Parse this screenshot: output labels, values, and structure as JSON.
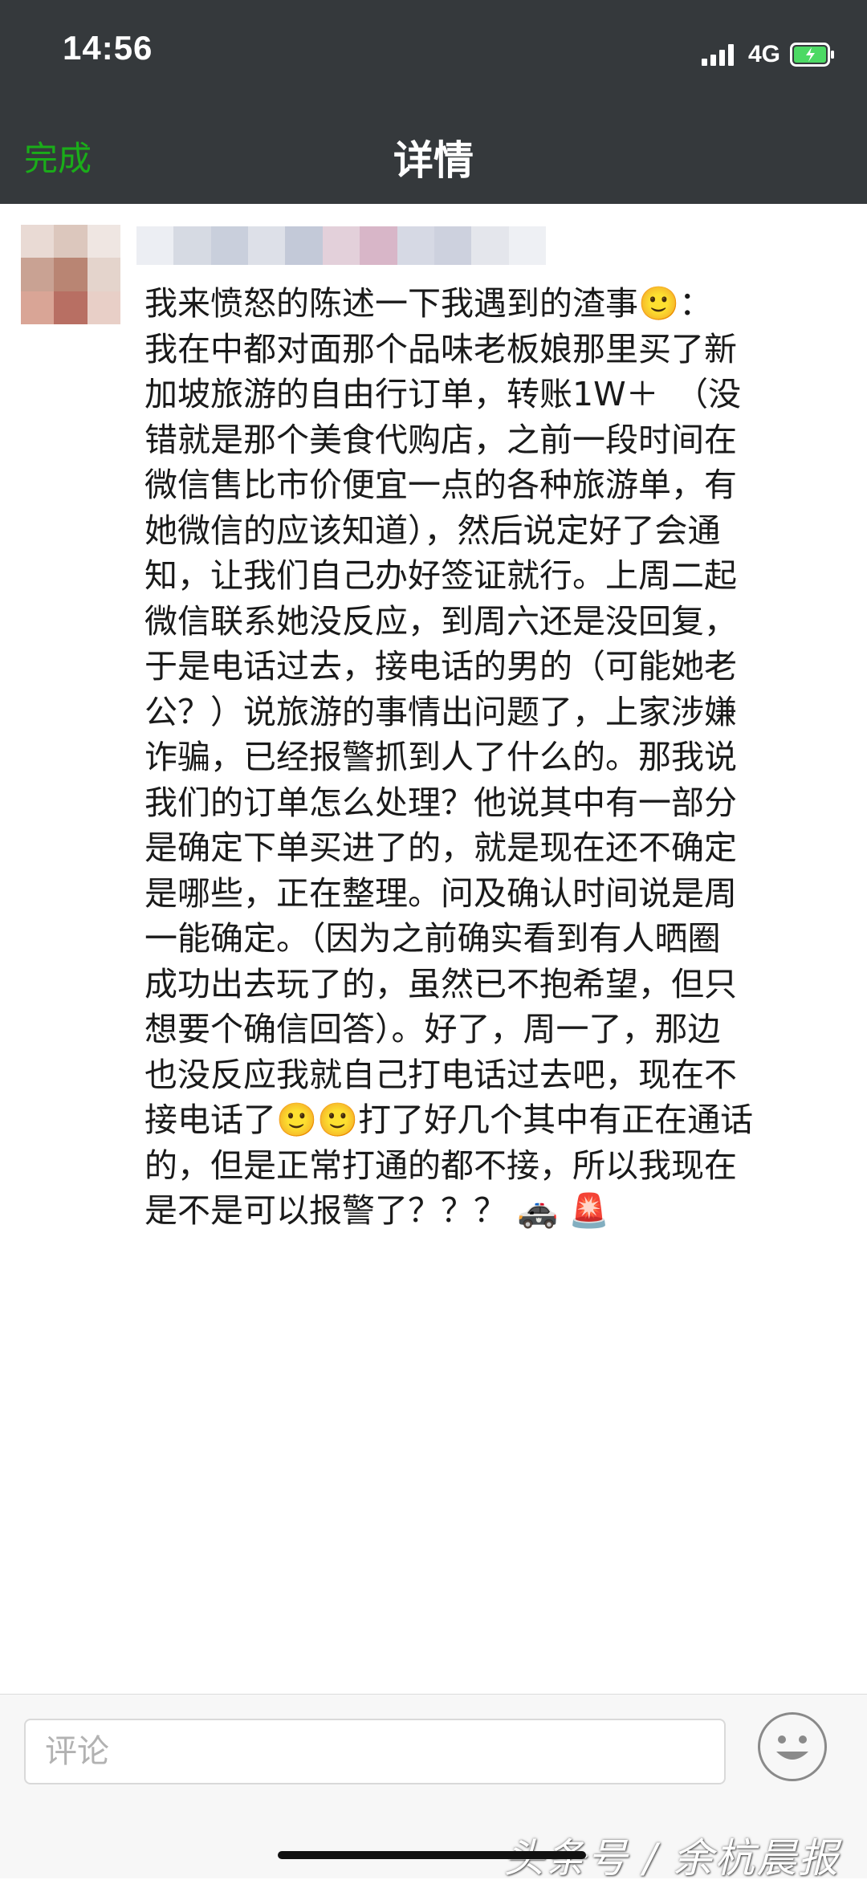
{
  "status_bar": {
    "time": "14:56",
    "network": "4G"
  },
  "nav": {
    "done_label": "完成",
    "title": "详情"
  },
  "post": {
    "text": "我来愤怒的陈述一下我遇到的渣事🙂：\n我在中都对面那个品味老板娘那里买了新\n加坡旅游的自由行订单，转账1W＋　（没\n错就是那个美食代购店，之前一段时间在\n微信售比市价便宜一点的各种旅游单，有\n她微信的应该知道），然后说定好了会通\n知，让我们自己办好签证就行。上周二起\n微信联系她没反应，到周六还是没回复，\n于是电话过去，接电话的男的（可能她老\n公？）说旅游的事情出问题了，上家涉嫌\n诈骗，已经报警抓到人了什么的。那我说\n我们的订单怎么处理？他说其中有一部分\n是确定下单买进了的，就是现在还不确定\n是哪些，正在整理。问及确认时间说是周\n一能确定。（因为之前确实看到有人晒圈\n成功出去玩了的，虽然已不抱希望，但只\n想要个确信回答）。好了，周一了，那边\n也没反应我就自己打电话过去吧，现在不\n接电话了🙂🙂打了好几个其中有正在通话\n的，但是正常打通的都不接，所以我现在\n是不是可以报警了？？？ 🚓 🚨"
  },
  "comment_bar": {
    "placeholder": "评论",
    "emoji_icon": "smiley-icon"
  },
  "watermark": "头条号 / 余杭晨报",
  "colors": {
    "nav_bg": "#35393c",
    "accent_green": "#1aad19",
    "text": "#1a1a1a",
    "placeholder": "#b2b2b2"
  }
}
